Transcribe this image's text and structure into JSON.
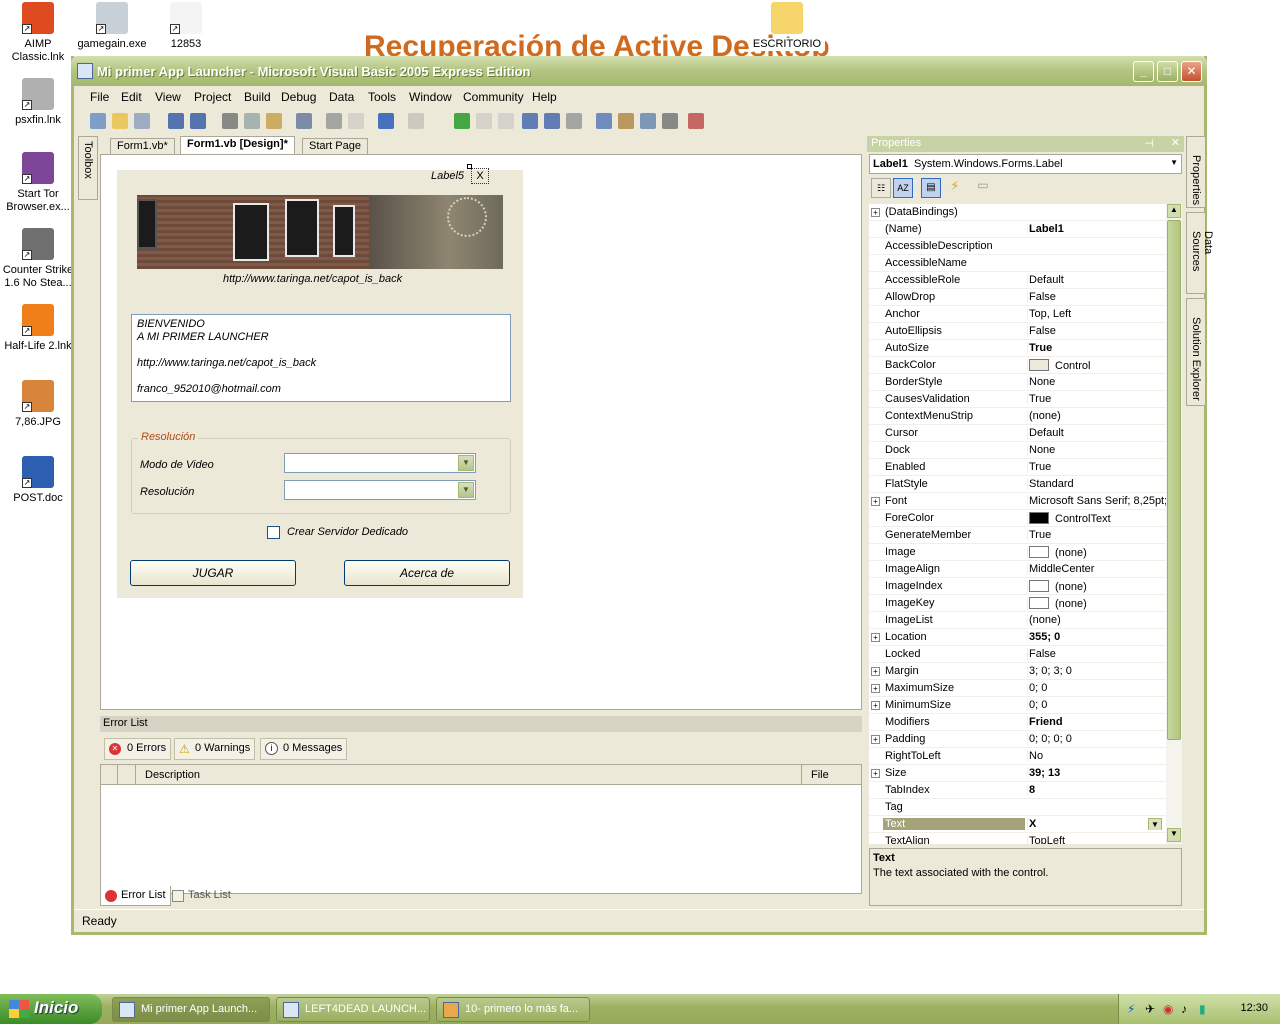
{
  "desktop": {
    "background_text": "Recuperación de Active Desktop",
    "icons": [
      {
        "label": "AIMP Classic.lnk",
        "icon": "aimp-icon",
        "color": "#e04a20"
      },
      {
        "label": "gamegain.exe",
        "icon": "recycle-icon",
        "color": "#c8d0d8"
      },
      {
        "label": "12853",
        "icon": "file-icon",
        "color": "#f4f4f4"
      },
      {
        "label": "ESCRITORIO",
        "icon": "folder-icon",
        "color": "#f6d66a"
      },
      {
        "label": "psxfin.lnk",
        "icon": "psx-icon",
        "color": "#b0b0b0"
      },
      {
        "label": "Start Tor Browser.ex...",
        "icon": "tor-onion-icon",
        "color": "#7d4698"
      },
      {
        "label": "Counter Strike 1.6 No Stea...",
        "icon": "counter-strike-icon",
        "color": "#707070"
      },
      {
        "label": "Half-Life 2.lnk",
        "icon": "half-life-icon",
        "color": "#f07f1a"
      },
      {
        "label": "7,86.JPG",
        "icon": "image-icon",
        "color": "#d8843a"
      },
      {
        "label": "POST.doc",
        "icon": "word-doc-icon",
        "color": "#2c5fb0"
      }
    ]
  },
  "window": {
    "title": "Mi primer App Launcher - Microsoft Visual Basic 2005 Express Edition",
    "menu": [
      "File",
      "Edit",
      "View",
      "Project",
      "Build",
      "Debug",
      "Data",
      "Tools",
      "Window",
      "Community",
      "Help"
    ],
    "doc_tabs": [
      "Form1.vb*",
      "Form1.vb [Design]*",
      "Start Page"
    ],
    "toolbox_label": "Toolbox",
    "status": "Ready"
  },
  "form": {
    "label5": "Label5",
    "label_x": "X",
    "banner_link": "http://www.taringa.net/capot_is_back",
    "welcome_lines": [
      "BIENVENIDO",
      "A MI PRIMER LAUNCHER",
      "",
      "http://www.taringa.net/capot_is_back",
      "",
      "franco_952010@hotmail.com"
    ],
    "group_title": "Resolución",
    "video_mode_label": "Modo de Video",
    "resolution_label": "Resolución",
    "dedicated_server_label": "Crear Servidor Dedicado",
    "play_button": "JUGAR",
    "about_button": "Acerca de"
  },
  "error_list": {
    "title": "Error List",
    "errors": "0 Errors",
    "warnings": "0 Warnings",
    "messages": "0 Messages",
    "col_description": "Description",
    "col_file": "File",
    "tab_error": "Error List",
    "tab_task": "Task List"
  },
  "properties": {
    "title": "Properties",
    "object_name": "Label1",
    "object_type": "System.Windows.Forms.Label",
    "rows": [
      {
        "name": "(DataBindings)",
        "value": "",
        "expand": true
      },
      {
        "name": "(Name)",
        "value": "Label1",
        "bold": true
      },
      {
        "name": "AccessibleDescription",
        "value": ""
      },
      {
        "name": "AccessibleName",
        "value": ""
      },
      {
        "name": "AccessibleRole",
        "value": "Default"
      },
      {
        "name": "AllowDrop",
        "value": "False"
      },
      {
        "name": "Anchor",
        "value": "Top, Left"
      },
      {
        "name": "AutoEllipsis",
        "value": "False"
      },
      {
        "name": "AutoSize",
        "value": "True",
        "bold": true
      },
      {
        "name": "BackColor",
        "value": "Control",
        "swatch": "#ece9d8"
      },
      {
        "name": "BorderStyle",
        "value": "None"
      },
      {
        "name": "CausesValidation",
        "value": "True"
      },
      {
        "name": "ContextMenuStrip",
        "value": "(none)"
      },
      {
        "name": "Cursor",
        "value": "Default"
      },
      {
        "name": "Dock",
        "value": "None"
      },
      {
        "name": "Enabled",
        "value": "True"
      },
      {
        "name": "FlatStyle",
        "value": "Standard"
      },
      {
        "name": "Font",
        "value": "Microsoft Sans Serif; 8,25pt;",
        "expand": true
      },
      {
        "name": "ForeColor",
        "value": "ControlText",
        "swatch": "#000000"
      },
      {
        "name": "GenerateMember",
        "value": "True"
      },
      {
        "name": "Image",
        "value": "(none)",
        "swatch": "#ffffff"
      },
      {
        "name": "ImageAlign",
        "value": "MiddleCenter"
      },
      {
        "name": "ImageIndex",
        "value": "(none)",
        "swatch": "#ffffff"
      },
      {
        "name": "ImageKey",
        "value": "(none)",
        "swatch": "#ffffff"
      },
      {
        "name": "ImageList",
        "value": "(none)"
      },
      {
        "name": "Location",
        "value": "355; 0",
        "bold": true,
        "expand": true
      },
      {
        "name": "Locked",
        "value": "False"
      },
      {
        "name": "Margin",
        "value": "3; 0; 3; 0",
        "expand": true
      },
      {
        "name": "MaximumSize",
        "value": "0; 0",
        "expand": true
      },
      {
        "name": "MinimumSize",
        "value": "0; 0",
        "expand": true
      },
      {
        "name": "Modifiers",
        "value": "Friend",
        "bold": true
      },
      {
        "name": "Padding",
        "value": "0; 0; 0; 0",
        "expand": true
      },
      {
        "name": "RightToLeft",
        "value": "No"
      },
      {
        "name": "Size",
        "value": "39; 13",
        "bold": true,
        "expand": true
      },
      {
        "name": "TabIndex",
        "value": "8",
        "bold": true
      },
      {
        "name": "Tag",
        "value": ""
      },
      {
        "name": "Text",
        "value": "X",
        "bold": true,
        "selected": true
      },
      {
        "name": "TextAlign",
        "value": "TopLeft"
      }
    ],
    "desc_title": "Text",
    "desc_text": "The text associated with the control.",
    "side_tabs": [
      "Properties",
      "Data Sources",
      "Solution Explorer"
    ]
  },
  "taskbar": {
    "start": "Inicio",
    "tasks": [
      "Mi primer App Launch...",
      "LEFT4DEAD LAUNCH...",
      "10- primero lo más fa..."
    ],
    "clock": "12:30"
  }
}
